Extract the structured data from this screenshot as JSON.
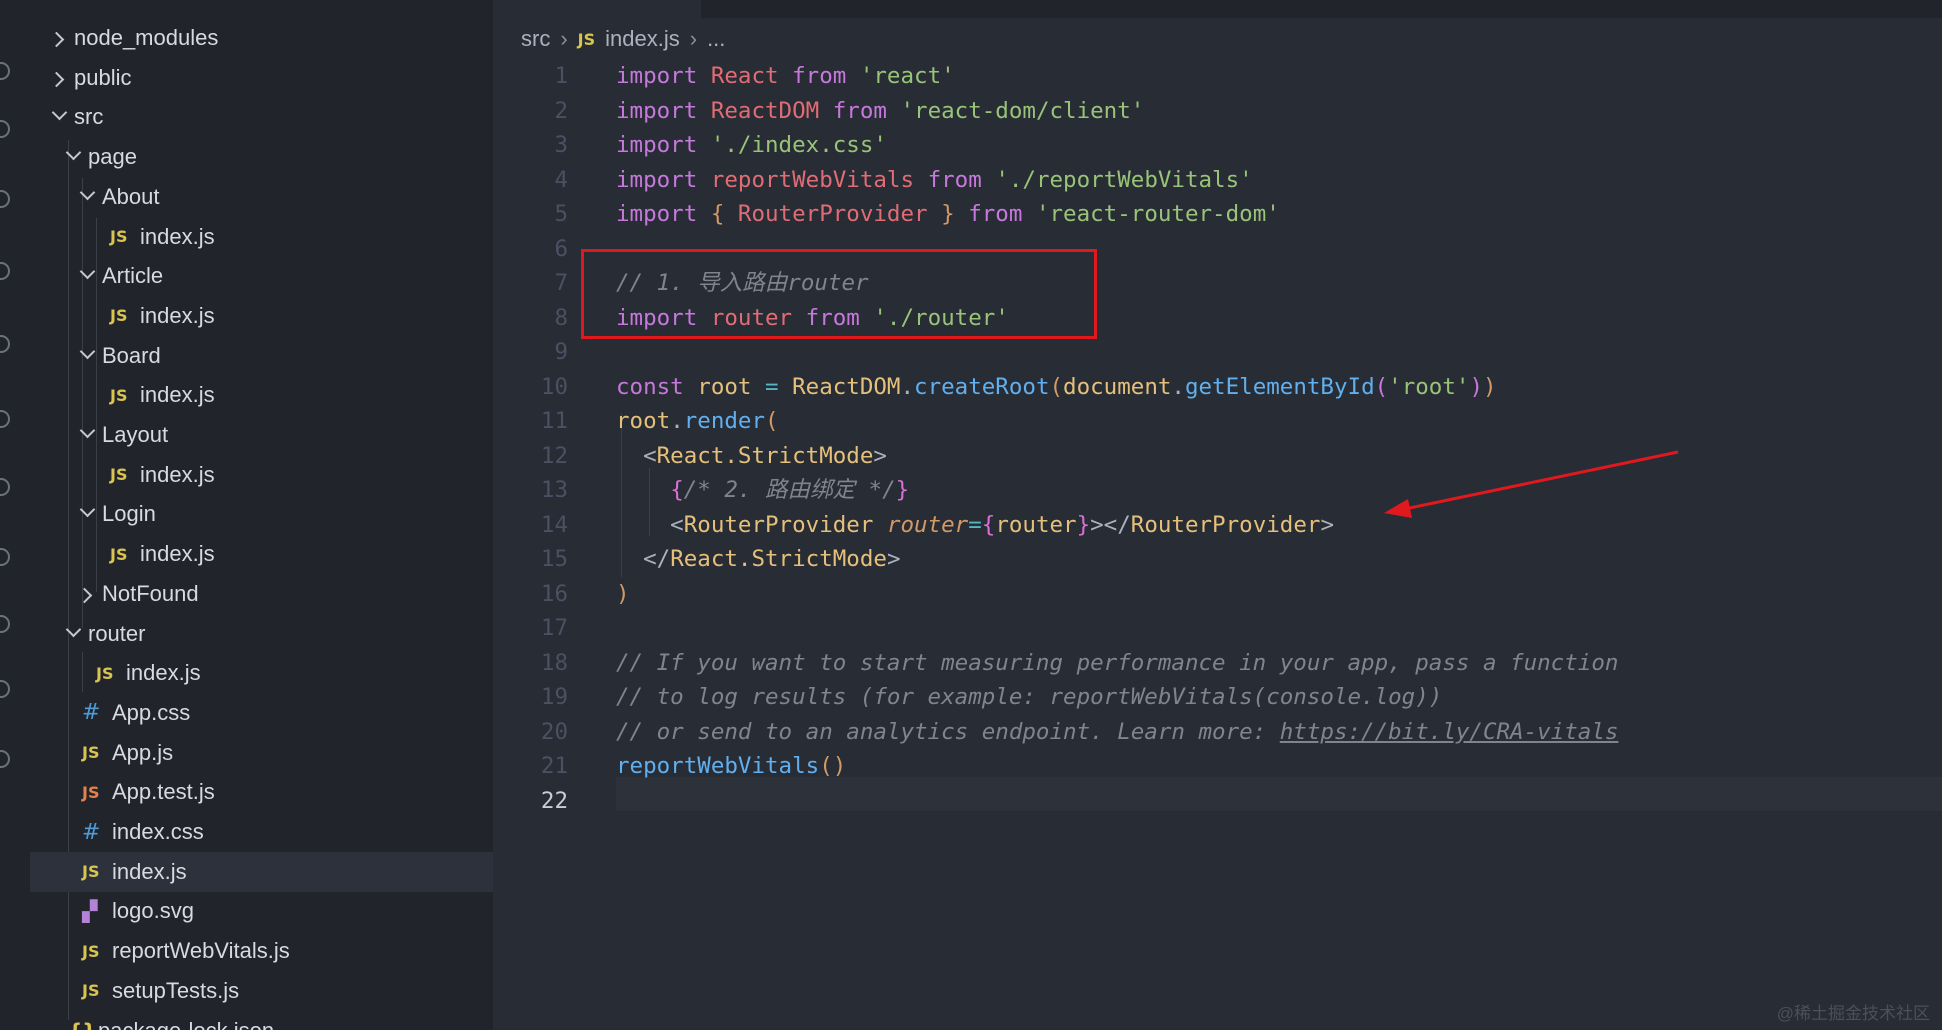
{
  "sidebar": {
    "items": [
      {
        "label": "node_modules",
        "kind": "folder",
        "state": "collapsed",
        "depth": 0
      },
      {
        "label": "public",
        "kind": "folder",
        "state": "collapsed",
        "depth": 0
      },
      {
        "label": "src",
        "kind": "folder",
        "state": "expanded",
        "depth": 0
      },
      {
        "label": "page",
        "kind": "folder",
        "state": "expanded",
        "depth": 1
      },
      {
        "label": "About",
        "kind": "folder",
        "state": "expanded",
        "depth": 2
      },
      {
        "label": "index.js",
        "kind": "js",
        "depth": 3
      },
      {
        "label": "Article",
        "kind": "folder",
        "state": "expanded",
        "depth": 2
      },
      {
        "label": "index.js",
        "kind": "js",
        "depth": 3
      },
      {
        "label": "Board",
        "kind": "folder",
        "state": "expanded",
        "depth": 2
      },
      {
        "label": "index.js",
        "kind": "js",
        "depth": 3
      },
      {
        "label": "Layout",
        "kind": "folder",
        "state": "expanded",
        "depth": 2
      },
      {
        "label": "index.js",
        "kind": "js",
        "depth": 3
      },
      {
        "label": "Login",
        "kind": "folder",
        "state": "expanded",
        "depth": 2
      },
      {
        "label": "index.js",
        "kind": "js",
        "depth": 3
      },
      {
        "label": "NotFound",
        "kind": "folder",
        "state": "collapsed",
        "depth": 2
      },
      {
        "label": "router",
        "kind": "folder",
        "state": "expanded",
        "depth": 1
      },
      {
        "label": "index.js",
        "kind": "js",
        "depth": 2
      },
      {
        "label": "App.css",
        "kind": "css",
        "depth": 1
      },
      {
        "label": "App.js",
        "kind": "js",
        "depth": 1
      },
      {
        "label": "App.test.js",
        "kind": "jstest",
        "depth": 1
      },
      {
        "label": "index.css",
        "kind": "css",
        "depth": 1
      },
      {
        "label": "index.js",
        "kind": "js",
        "depth": 1,
        "active": true
      },
      {
        "label": "logo.svg",
        "kind": "svg",
        "depth": 1
      },
      {
        "label": "reportWebVitals.js",
        "kind": "js",
        "depth": 1
      },
      {
        "label": "setupTests.js",
        "kind": "js",
        "depth": 1
      },
      {
        "label": "package-lock.json",
        "kind": "json",
        "depth": 0
      }
    ],
    "icon_text": {
      "js": "JS",
      "jstest": "JS",
      "css": "#",
      "svg": "▞",
      "json": "{}"
    }
  },
  "breadcrumb": {
    "folder": "src",
    "js_icon": "JS",
    "file": "index.js",
    "more": "..."
  },
  "editor": {
    "current_line": 22,
    "lines": [
      [
        [
          "kw",
          "import "
        ],
        [
          "var",
          "React "
        ],
        [
          "kw",
          "from "
        ],
        [
          "str",
          "'react'"
        ]
      ],
      [
        [
          "kw",
          "import "
        ],
        [
          "var",
          "ReactDOM "
        ],
        [
          "kw",
          "from "
        ],
        [
          "str",
          "'react-dom/client'"
        ]
      ],
      [
        [
          "kw",
          "import "
        ],
        [
          "str",
          "'./index.css'"
        ]
      ],
      [
        [
          "kw",
          "import "
        ],
        [
          "var",
          "reportWebVitals "
        ],
        [
          "kw",
          "from "
        ],
        [
          "str",
          "'./reportWebVitals'"
        ]
      ],
      [
        [
          "kw",
          "import "
        ],
        [
          "br1",
          "{ "
        ],
        [
          "var",
          "RouterProvider "
        ],
        [
          "br1",
          "} "
        ],
        [
          "kw",
          "from "
        ],
        [
          "str",
          "'react-router-dom'"
        ]
      ],
      [],
      [
        [
          "cmt",
          "// 1. 导入路由router"
        ]
      ],
      [
        [
          "kw",
          "import "
        ],
        [
          "var",
          "router "
        ],
        [
          "kw",
          "from "
        ],
        [
          "str",
          "'./router'"
        ]
      ],
      [],
      [
        [
          "kw",
          "const "
        ],
        [
          "tag",
          "root "
        ],
        [
          "op",
          "= "
        ],
        [
          "tag",
          "ReactDOM"
        ],
        [
          "pl",
          "."
        ],
        [
          "fn",
          "createRoot"
        ],
        [
          "br1",
          "("
        ],
        [
          "tag",
          "document"
        ],
        [
          "pl",
          "."
        ],
        [
          "fn",
          "getElementById"
        ],
        [
          "br2",
          "("
        ],
        [
          "str",
          "'root'"
        ],
        [
          "br2",
          ")"
        ],
        [
          "br1",
          ")"
        ]
      ],
      [
        [
          "tag",
          "root"
        ],
        [
          "pl",
          "."
        ],
        [
          "fn",
          "render"
        ],
        [
          "br1",
          "("
        ]
      ],
      [
        [
          "pl",
          "  <"
        ],
        [
          "tag",
          "React.StrictMode"
        ],
        [
          "pl",
          ">"
        ]
      ],
      [
        [
          "pl",
          "    "
        ],
        [
          "br3",
          "{"
        ],
        [
          "cmt",
          "/* 2. 路由绑定 */"
        ],
        [
          "br3",
          "}"
        ]
      ],
      [
        [
          "pl",
          "    <"
        ],
        [
          "tag",
          "RouterProvider "
        ],
        [
          "attr",
          "router"
        ],
        [
          "op",
          "="
        ],
        [
          "br3",
          "{"
        ],
        [
          "tag",
          "router"
        ],
        [
          "br3",
          "}"
        ],
        [
          "pl",
          "></"
        ],
        [
          "tag",
          "RouterProvider"
        ],
        [
          "pl",
          ">"
        ]
      ],
      [
        [
          "pl",
          "  </"
        ],
        [
          "tag",
          "React.StrictMode"
        ],
        [
          "pl",
          ">"
        ]
      ],
      [
        [
          "br1",
          ")"
        ]
      ],
      [],
      [
        [
          "cmt",
          "// If you want to start measuring performance in your app, pass a function"
        ]
      ],
      [
        [
          "cmt",
          "// to log results (for example: reportWebVitals(console.log))"
        ]
      ],
      [
        [
          "cmt",
          "// or send to an analytics endpoint. Learn more: "
        ],
        [
          "cmt link",
          "https://bit.ly/CRA-vitals"
        ]
      ],
      [
        [
          "fn",
          "reportWebVitals"
        ],
        [
          "br1",
          "()"
        ]
      ],
      []
    ]
  },
  "annotations": {
    "box_color": "#e0191f",
    "arrow_color": "#e0191f"
  },
  "watermark": "@稀土掘金技术社区"
}
